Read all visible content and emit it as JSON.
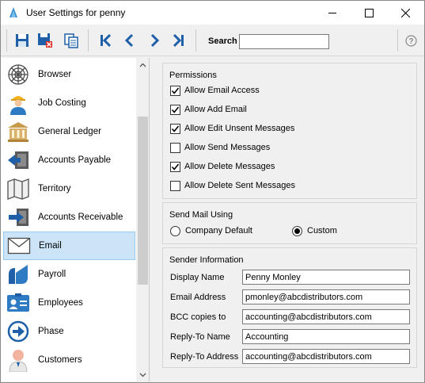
{
  "window": {
    "title": "User Settings for penny"
  },
  "toolbar": {
    "search_label": "Search",
    "search_value": ""
  },
  "modules": [
    {
      "label": "Browser",
      "icon": "web-icon"
    },
    {
      "label": "Job Costing",
      "icon": "worker-icon"
    },
    {
      "label": "General Ledger",
      "icon": "bank-icon"
    },
    {
      "label": "Accounts Payable",
      "icon": "payable-icon"
    },
    {
      "label": "Territory",
      "icon": "map-icon"
    },
    {
      "label": "Accounts Receivable",
      "icon": "receivable-icon"
    },
    {
      "label": "Email",
      "icon": "envelope-icon",
      "selected": true
    },
    {
      "label": "Payroll",
      "icon": "payroll-icon"
    },
    {
      "label": "Employees",
      "icon": "id-card-icon"
    },
    {
      "label": "Phase",
      "icon": "arrow-circle-icon"
    },
    {
      "label": "Customers",
      "icon": "customer-icon"
    }
  ],
  "permissions": {
    "title": "Permissions",
    "items": [
      {
        "label": "Allow Email Access",
        "checked": true
      },
      {
        "label": "Allow Add Email",
        "checked": true
      },
      {
        "label": "Allow Edit Unsent Messages",
        "checked": true
      },
      {
        "label": "Allow Send Messages",
        "checked": false
      },
      {
        "label": "Allow Delete Messages",
        "checked": true
      },
      {
        "label": "Allow Delete Sent Messages",
        "checked": false
      }
    ]
  },
  "send_mail": {
    "title": "Send Mail Using",
    "options": [
      {
        "label": "Company Default",
        "selected": false
      },
      {
        "label": "Custom",
        "selected": true
      }
    ]
  },
  "sender": {
    "title": "Sender Information",
    "fields": [
      {
        "label": "Display Name",
        "value": "Penny Monley"
      },
      {
        "label": "Email Address",
        "value": "pmonley@abcdistributors.com"
      },
      {
        "label": "BCC copies to",
        "value": "accounting@abcdistributors.com"
      },
      {
        "label": "Reply-To Name",
        "value": "Accounting"
      },
      {
        "label": "Reply-To Address",
        "value": "accounting@abcdistributors.com"
      }
    ]
  },
  "colors": {
    "accent": "#1e5fa8",
    "selected_bg": "#cce4f7",
    "selected_border": "#99c9ef"
  }
}
